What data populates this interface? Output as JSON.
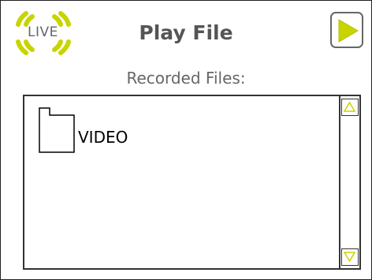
{
  "header": {
    "logo_text": "LIVE",
    "logo_small_text": "",
    "title": "Play File"
  },
  "play_button": {
    "icon": "play-icon",
    "color": "#c8d400"
  },
  "files_section": {
    "label": "Recorded Files:",
    "items": [
      {
        "name": "VIDEO",
        "icon": "folder-icon"
      }
    ]
  },
  "scrollbar": {
    "up_icon": "triangle-up-icon",
    "down_icon": "triangle-down-icon",
    "arrow_color": "#c8d400"
  },
  "colors": {
    "accent": "#c8d400",
    "title_text": "#555555",
    "border": "#333333"
  }
}
